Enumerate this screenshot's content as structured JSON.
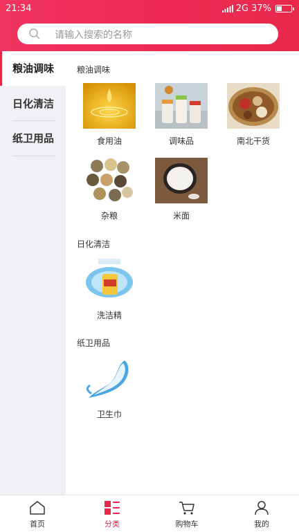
{
  "status": {
    "time": "21:34",
    "network": "2G",
    "battery": "37%"
  },
  "search": {
    "placeholder": "请输入搜索的名称"
  },
  "sidebar": {
    "items": [
      {
        "label": "粮油调味",
        "active": true
      },
      {
        "label": "日化清洁",
        "active": false
      },
      {
        "label": "纸卫用品",
        "active": false
      }
    ]
  },
  "sections": [
    {
      "title": "粮油调味",
      "items": [
        {
          "name": "食用油",
          "image": "cooking-oil-drop"
        },
        {
          "name": "调味品",
          "image": "seasoning-jars"
        },
        {
          "name": "南北干货",
          "image": "dried-goods-basket"
        },
        {
          "name": "杂粮",
          "image": "grain-bowls"
        },
        {
          "name": "米面",
          "image": "rice-bowl"
        }
      ]
    },
    {
      "title": "日化清洁",
      "items": [
        {
          "name": "洗洁精",
          "image": "detergent-bottle"
        }
      ]
    },
    {
      "title": "纸卫用品",
      "items": [
        {
          "name": "卫生巾",
          "image": "sanitary-pad"
        }
      ]
    }
  ],
  "tabbar": {
    "items": [
      {
        "label": "首页",
        "icon": "home-icon"
      },
      {
        "label": "分类",
        "icon": "category-icon",
        "active": true
      },
      {
        "label": "购物车",
        "icon": "cart-icon"
      },
      {
        "label": "我的",
        "icon": "user-icon"
      }
    ]
  },
  "colors": {
    "accent": "#e8294c",
    "sidebar_bg": "#f1f0f5"
  }
}
